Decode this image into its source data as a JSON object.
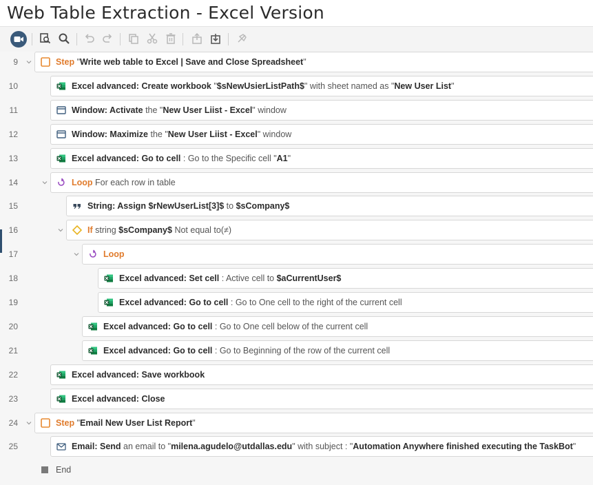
{
  "title": "Web Table Extraction - Excel Version",
  "toolbar": {
    "buttons": [
      "record-button",
      "search-results",
      "search",
      "undo",
      "redo",
      "copy",
      "cut",
      "delete",
      "export",
      "import",
      "disable"
    ]
  },
  "rows": [
    {
      "num": "9",
      "parts": [
        [
          "orange",
          "Step "
        ],
        [
          "plain",
          "\""
        ],
        [
          "bold",
          "Write web table to Excel | Save and Close Spreadsheet"
        ],
        [
          "plain",
          "\""
        ]
      ]
    },
    {
      "num": "10",
      "parts": [
        [
          "bold",
          "Excel advanced: Create workbook "
        ],
        [
          "plain",
          "\""
        ],
        [
          "bold",
          "$sNewUsierListPath$"
        ],
        [
          "plain",
          "\" with sheet named as \""
        ],
        [
          "bold",
          "New User List"
        ],
        [
          "plain",
          "\""
        ]
      ]
    },
    {
      "num": "11",
      "parts": [
        [
          "bold",
          "Window: Activate"
        ],
        [
          "plain",
          " the \""
        ],
        [
          "bold",
          "New User Liist - Excel"
        ],
        [
          "plain",
          "\" window"
        ]
      ]
    },
    {
      "num": "12",
      "parts": [
        [
          "bold",
          "Window: Maximize"
        ],
        [
          "plain",
          " the \""
        ],
        [
          "bold",
          "New User Liist - Excel"
        ],
        [
          "plain",
          "\" window"
        ]
      ]
    },
    {
      "num": "13",
      "parts": [
        [
          "bold",
          "Excel advanced: Go to cell"
        ],
        [
          "plain",
          " : Go to the Specific cell \""
        ],
        [
          "bold",
          "A1"
        ],
        [
          "plain",
          "\""
        ]
      ]
    },
    {
      "num": "14",
      "parts": [
        [
          "purple",
          "Loop"
        ],
        [
          "plain",
          " For each row in table"
        ]
      ]
    },
    {
      "num": "15",
      "parts": [
        [
          "bold",
          "String: Assign "
        ],
        [
          "bold",
          "$rNewUserList[3]$"
        ],
        [
          "plain",
          " to "
        ],
        [
          "bold",
          "$sCompany$"
        ]
      ]
    },
    {
      "num": "16",
      "parts": [
        [
          "orange",
          "If"
        ],
        [
          "plain",
          " string "
        ],
        [
          "bold",
          "$sCompany$"
        ],
        [
          "plain",
          " Not equal to(≠)"
        ]
      ]
    },
    {
      "num": "17",
      "parts": [
        [
          "purple",
          "Loop"
        ]
      ]
    },
    {
      "num": "18",
      "parts": [
        [
          "bold",
          "Excel advanced: Set cell"
        ],
        [
          "plain",
          " : Active cell to "
        ],
        [
          "bold",
          "$aCurrentUser$"
        ]
      ]
    },
    {
      "num": "19",
      "parts": [
        [
          "bold",
          "Excel advanced: Go to cell"
        ],
        [
          "plain",
          " : Go to One cell to the right of the current cell"
        ]
      ]
    },
    {
      "num": "20",
      "parts": [
        [
          "bold",
          "Excel advanced: Go to cell"
        ],
        [
          "plain",
          " : Go to One cell below of the current cell"
        ]
      ]
    },
    {
      "num": "21",
      "parts": [
        [
          "bold",
          "Excel advanced: Go to cell"
        ],
        [
          "plain",
          " : Go to Beginning of the row of the current cell"
        ]
      ]
    },
    {
      "num": "22",
      "parts": [
        [
          "bold",
          "Excel advanced: Save workbook"
        ]
      ]
    },
    {
      "num": "23",
      "parts": [
        [
          "bold",
          "Excel advanced: Close"
        ]
      ]
    },
    {
      "num": "24",
      "parts": [
        [
          "orange",
          "Step "
        ],
        [
          "plain",
          "\""
        ],
        [
          "bold",
          "Email New User List Report"
        ],
        [
          "plain",
          "\""
        ]
      ]
    },
    {
      "num": "25",
      "parts": [
        [
          "bold",
          "Email: Send"
        ],
        [
          "plain",
          " an email to \""
        ],
        [
          "bold",
          "milena.agudelo@utdallas.edu"
        ],
        [
          "plain",
          "\" with subject : \""
        ],
        [
          "bold",
          "Automation Anywhere finished executing the TaskBot"
        ],
        [
          "plain",
          "\""
        ]
      ]
    }
  ],
  "end_label": "End",
  "colors": {
    "accent": "#e07b2c",
    "excel": "#1d6f42",
    "loop": "#9b4fc2",
    "if": "#e8b422",
    "record": "#3a5a7a"
  }
}
